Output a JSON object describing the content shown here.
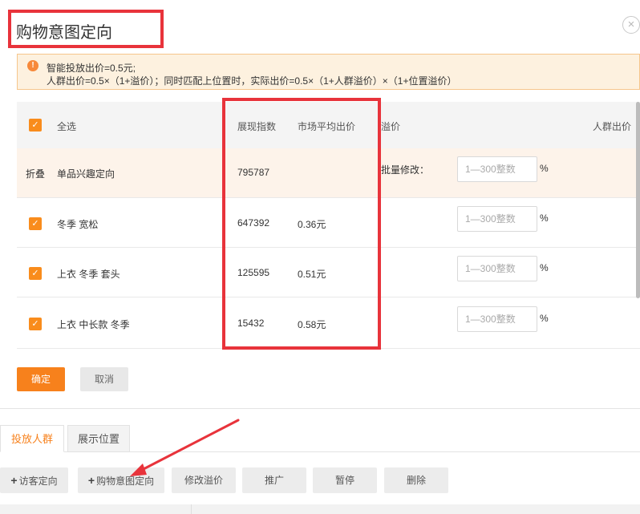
{
  "modal": {
    "title": "购物意图定向",
    "close_glyph": "×",
    "notice": {
      "icon": "!",
      "line1": "智能投放出价=0.5元;",
      "line2": "人群出价=0.5×（1+溢价）；同时匹配上位置时，实际出价=0.5×（1+人群溢价）×（1+位置溢价）"
    },
    "table": {
      "headers": {
        "select_all": "全选",
        "impression_index": "展现指数",
        "avg_market_bid": "市场平均出价",
        "premium": "溢价",
        "crowd_bid": "人群出价"
      },
      "group": {
        "toggle": "折叠",
        "name": "单品兴趣定向",
        "impression_index": "795787",
        "batch_label": "批量修改：",
        "placeholder": "1—300整数",
        "unit": "%"
      },
      "rows": [
        {
          "name": "冬季 宽松",
          "impression_index": "647392",
          "avg_bid": "0.36元",
          "placeholder": "1—300整数",
          "unit": "%"
        },
        {
          "name": "上衣 冬季 套头",
          "impression_index": "125595",
          "avg_bid": "0.51元",
          "placeholder": "1—300整数",
          "unit": "%"
        },
        {
          "name": "上衣 中长款 冬季",
          "impression_index": "15432",
          "avg_bid": "0.58元",
          "placeholder": "1—300整数",
          "unit": "%"
        }
      ]
    },
    "buttons": {
      "confirm": "确定",
      "cancel": "取消"
    }
  },
  "tabs": {
    "crowd": "投放人群",
    "position": "展示位置"
  },
  "toolbar": {
    "visitor_targeting": "访客定向",
    "purchase_intent": "购物意图定向",
    "modify_premium": "修改溢价",
    "promote": "推广",
    "pause": "暂停",
    "delete": "删除"
  },
  "colors": {
    "accent": "#f7811c",
    "annotation": "#e8333b",
    "notice_bg": "#fdf1df"
  },
  "icons": {
    "notice": "warning-icon",
    "close": "close-icon",
    "check": "check-icon",
    "plus": "plus-icon"
  }
}
